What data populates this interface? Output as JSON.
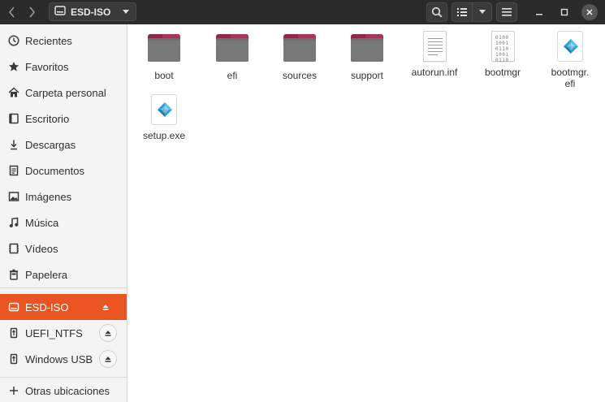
{
  "header": {
    "location": "ESD-ISO"
  },
  "sidebar": {
    "items": [
      {
        "label": "Recientes",
        "icon": "clock-icon"
      },
      {
        "label": "Favoritos",
        "icon": "star-icon"
      },
      {
        "label": "Carpeta personal",
        "icon": "home-icon"
      },
      {
        "label": "Escritorio",
        "icon": "desktop-icon"
      },
      {
        "label": "Descargas",
        "icon": "download-icon"
      },
      {
        "label": "Documentos",
        "icon": "document-icon"
      },
      {
        "label": "Imágenes",
        "icon": "image-icon"
      },
      {
        "label": "Música",
        "icon": "music-icon"
      },
      {
        "label": "Vídeos",
        "icon": "video-icon"
      },
      {
        "label": "Papelera",
        "icon": "trash-icon"
      }
    ],
    "devices": [
      {
        "label": "ESD-ISO",
        "icon": "drive-icon",
        "active": true
      },
      {
        "label": "UEFI_NTFS",
        "icon": "usb-icon",
        "active": false
      },
      {
        "label": "Windows USB",
        "icon": "usb-icon",
        "active": false
      }
    ],
    "other": {
      "label": "Otras ubicaciones",
      "icon": "plus-icon"
    }
  },
  "files": [
    {
      "name": "boot",
      "type": "folder"
    },
    {
      "name": "efi",
      "type": "folder"
    },
    {
      "name": "sources",
      "type": "folder"
    },
    {
      "name": "support",
      "type": "folder"
    },
    {
      "name": "autorun.inf",
      "type": "text"
    },
    {
      "name": "bootmgr",
      "type": "binary"
    },
    {
      "name": "bootmgr.\nefi",
      "type": "executable"
    },
    {
      "name": "setup.exe",
      "type": "executable"
    }
  ],
  "colors": {
    "accent": "#e95420",
    "headerbar": "#2b2b2b",
    "folder_tab": "#8d2a4a",
    "folder_body": "#787878",
    "windows_blue": "#2a9fd8"
  }
}
